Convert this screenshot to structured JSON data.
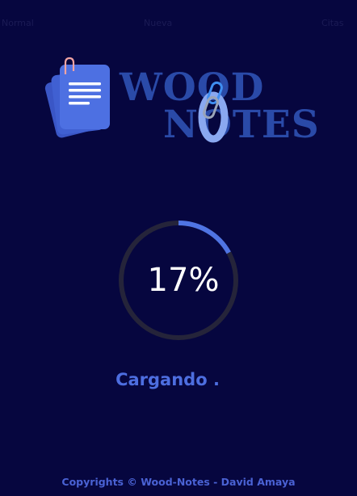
{
  "app": {
    "brand_line1": "WOOD",
    "brand_line2": "NOTES",
    "logo_icon": "document-stack-icon",
    "link_icon": "chain-link-icon"
  },
  "loader": {
    "progress_label": "17%",
    "progress_fraction": 0.17,
    "status": "Cargando ."
  },
  "footer": {
    "text": "Copyrights © Wood-Notes - David Amaya"
  },
  "colors": {
    "background": "#06063f",
    "accent": "#4d6ee0",
    "ring_track": "#25243a",
    "ring_progress": "#4f74e3",
    "brand_text": "#2a4aa8"
  }
}
